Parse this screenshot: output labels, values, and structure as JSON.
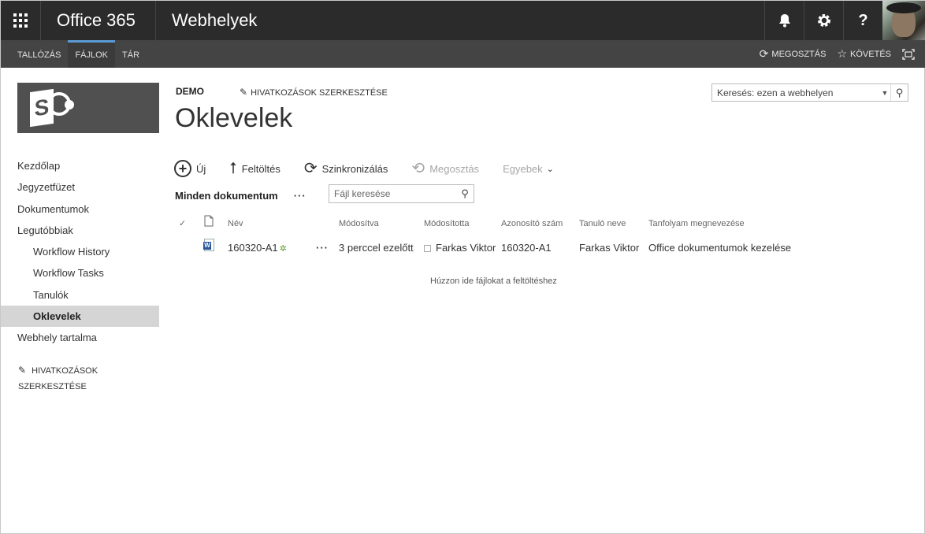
{
  "suite": {
    "brand": "Office 365",
    "site": "Webhelyek",
    "icons": [
      "bell-icon",
      "gear-icon",
      "help-icon"
    ]
  },
  "ribbon": {
    "tabs": [
      "TALLÓZÁS",
      "FÁJLOK",
      "TÁR"
    ],
    "selected_tab": "FÁJLOK",
    "share": "MEGOSZTÁS",
    "follow": "KÖVETÉS"
  },
  "breadcrumb": "DEMO",
  "edit_links": "HIVATKOZÁSOK SZERKESZTÉSE",
  "edit_links_left_line1": "HIVATKOZÁSOK",
  "edit_links_left_line2": "SZERKESZTÉSE",
  "page_title": "Oklevelek",
  "search": {
    "placeholder": "Keresés: ezen a webhelyen"
  },
  "quicklaunch": {
    "items": [
      {
        "label": "Kezdőlap"
      },
      {
        "label": "Jegyzetfüzet"
      },
      {
        "label": "Dokumentumok"
      },
      {
        "label": "Legutóbbiak"
      },
      {
        "label": "Workflow History"
      },
      {
        "label": "Workflow Tasks"
      },
      {
        "label": "Tanulók"
      },
      {
        "label": "Oklevelek"
      },
      {
        "label": "Webhely tartalma"
      }
    ]
  },
  "commands": {
    "new": "Új",
    "upload": "Feltöltés",
    "sync": "Szinkronizálás",
    "share": "Megosztás",
    "more": "Egyebek"
  },
  "view": {
    "name": "Minden dokumentum",
    "file_search_placeholder": "Fájl keresése"
  },
  "table": {
    "headers": {
      "name": "Név",
      "modified": "Módosítva",
      "modified_by": "Módosította",
      "id": "Azonosító szám",
      "student": "Tanuló neve",
      "course": "Tanfolyam megnevezése"
    },
    "rows": [
      {
        "name": "160320-A1",
        "modified": "3 perccel ezelőtt",
        "modified_by": "Farkas Viktor",
        "id": "160320-A1",
        "student": "Farkas Viktor",
        "course": "Office dokumentumok kezelése"
      }
    ]
  },
  "drop_hint": "Húzzon ide fájlokat a feltöltéshez"
}
